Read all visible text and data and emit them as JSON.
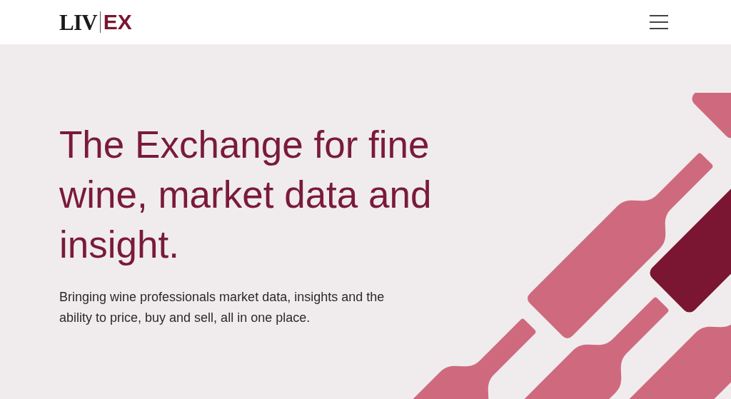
{
  "header": {
    "logo": {
      "left": "LIV",
      "right": "EX"
    }
  },
  "hero": {
    "headline": "The Exchange for fine wine, market data and insight.",
    "subtitle": "Bringing wine professionals market data, insights and the ability to price, buy and sell, all in one place."
  }
}
